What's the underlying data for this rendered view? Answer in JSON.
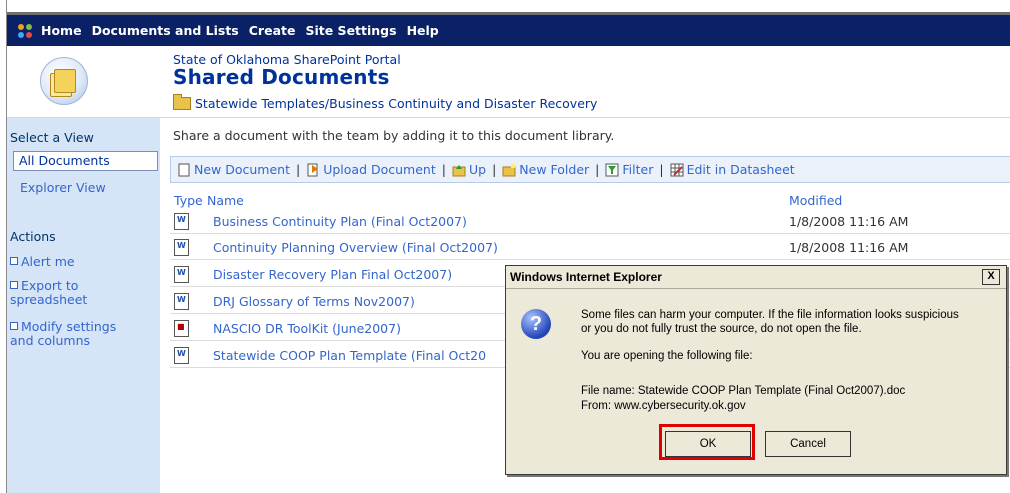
{
  "nav": {
    "items": [
      "Home",
      "Documents and Lists",
      "Create",
      "Site Settings",
      "Help"
    ]
  },
  "header": {
    "portal": "State of Oklahoma SharePoint Portal",
    "title": "Shared Documents",
    "breadcrumb": "Statewide Templates/Business Continuity and Disaster Recovery"
  },
  "sidebar": {
    "select_view": "Select a View",
    "views": [
      "All Documents",
      "Explorer View"
    ],
    "actions_label": "Actions",
    "actions": [
      "Alert me",
      "Export to\nspreadsheet",
      "Modify settings\nand columns"
    ]
  },
  "main": {
    "description": "Share a document with the team by adding it to this document library.",
    "toolbar": [
      "New Document",
      "Upload Document",
      "Up",
      "New Folder",
      "Filter",
      "Edit in Datasheet"
    ],
    "columns": {
      "type": "Type",
      "name": "Name",
      "modified": "Modified"
    },
    "rows": [
      {
        "name": "Business Continuity Plan (Final Oct2007)",
        "modified": "1/8/2008 11:16 AM",
        "icon": "word-doc-icon"
      },
      {
        "name": "Continuity Planning Overview (Final Oct2007)",
        "modified": "1/8/2008 11:16 AM",
        "icon": "word-doc-icon"
      },
      {
        "name": "Disaster Recovery Plan Final Oct2007)",
        "modified": "",
        "icon": "word-doc-icon"
      },
      {
        "name": "DRJ Glossary of Terms Nov2007)",
        "modified": "",
        "icon": "word-doc-icon"
      },
      {
        "name": "NASCIO DR ToolKit (June2007)",
        "modified": "",
        "icon": "pdf-doc-icon"
      },
      {
        "name": "Statewide COOP Plan Template (Final Oct20",
        "modified": "",
        "icon": "word-doc-icon"
      }
    ]
  },
  "dialog": {
    "title": "Windows Internet Explorer",
    "close": "X",
    "warning_line1": "Some files can harm your computer. If the file information looks suspicious",
    "warning_line2": "or you do not fully trust the source, do not open the file.",
    "opening": "You are opening the following file:",
    "file_name": "File name: Statewide COOP Plan Template (Final Oct2007).doc",
    "from": "From: www.cybersecurity.ok.gov",
    "ok": "OK",
    "cancel": "Cancel"
  },
  "colors": {
    "nav_bg": "#0b2165",
    "sidebar_bg": "#d6e4f7",
    "link": "#3366cc",
    "highlight": "#e00000"
  }
}
